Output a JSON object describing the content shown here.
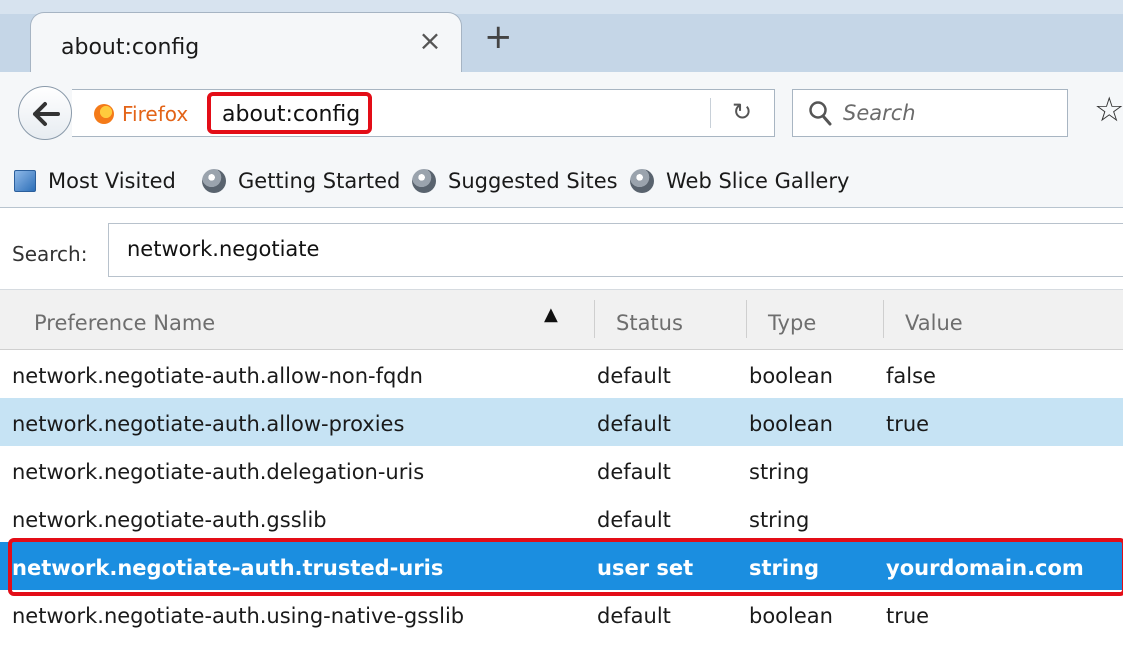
{
  "tab": {
    "title": "about:config",
    "close_glyph": "×",
    "new_tab_glyph": "+"
  },
  "navbar": {
    "identity_label": "Firefox",
    "url": "about:config",
    "search_placeholder": "Search",
    "icons": [
      "back-arrow-icon",
      "firefox-icon",
      "reload-icon",
      "search-icon",
      "bookmark-star-icon"
    ]
  },
  "bookmarks": [
    {
      "label": "Most Visited",
      "icon": "most-visited-icon"
    },
    {
      "label": "Getting Started",
      "icon": "globe-icon"
    },
    {
      "label": "Suggested Sites",
      "icon": "globe-icon"
    },
    {
      "label": "Web Slice Gallery",
      "icon": "globe-icon"
    }
  ],
  "config": {
    "search_label": "Search:",
    "search_value": "network.negotiate",
    "columns": {
      "name": "Preference Name",
      "status": "Status",
      "type": "Type",
      "value": "Value"
    },
    "sort_indicator": "▲",
    "rows": [
      {
        "name": "network.negotiate-auth.allow-non-fqdn",
        "status": "default",
        "type": "boolean",
        "value": "false"
      },
      {
        "name": "network.negotiate-auth.allow-proxies",
        "status": "default",
        "type": "boolean",
        "value": "true"
      },
      {
        "name": "network.negotiate-auth.delegation-uris",
        "status": "default",
        "type": "string",
        "value": ""
      },
      {
        "name": "network.negotiate-auth.gsslib",
        "status": "default",
        "type": "string",
        "value": ""
      },
      {
        "name": "network.negotiate-auth.trusted-uris",
        "status": "user set",
        "type": "string",
        "value": "yourdomain.com"
      },
      {
        "name": "network.negotiate-auth.using-native-gsslib",
        "status": "default",
        "type": "boolean",
        "value": "true"
      }
    ]
  },
  "colors": {
    "highlight_outline": "#e30d17",
    "selected_row": "#1b8ee0",
    "hover_row": "#c6e3f4"
  }
}
